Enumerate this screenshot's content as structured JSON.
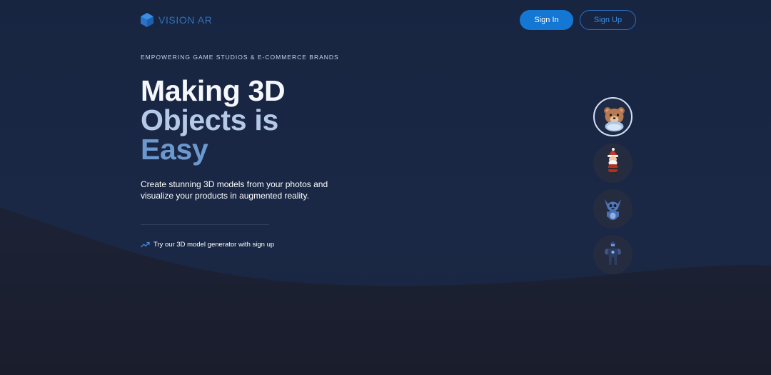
{
  "brand": {
    "name": "VISION AR",
    "accent_color": "#2f71b8"
  },
  "header": {
    "sign_in_label": "Sign In",
    "sign_up_label": "Sign Up"
  },
  "hero": {
    "kicker": "EMPOWERING GAME STUDIOS & E-COMMERCE BRANDS",
    "headline_line1": "Making 3D",
    "headline_line2": "Objects is",
    "headline_line3": "Easy",
    "subtext": "Create stunning 3D models from your photos and visualize your products in augmented reality.",
    "try_link_icon": "trending-up-icon",
    "try_link_label": "Try our 3D model generator with sign up"
  },
  "gallery": {
    "items": [
      {
        "name": "teddy-bear-model",
        "selected": true
      },
      {
        "name": "santa-model",
        "selected": false
      },
      {
        "name": "blue-creature-model",
        "selected": false
      },
      {
        "name": "armored-robot-model",
        "selected": false
      }
    ]
  },
  "colors": {
    "primary_button": "#1477d4",
    "background_top": "#172541",
    "background_bottom": "#1a1e2f"
  }
}
